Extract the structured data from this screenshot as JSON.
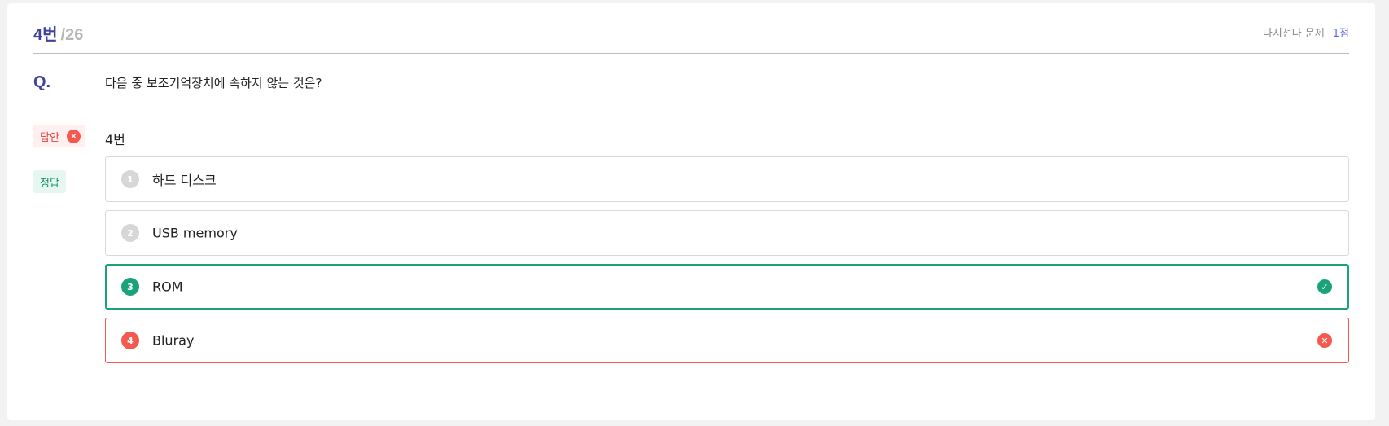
{
  "question": {
    "number": "4번",
    "total": "/26",
    "type": "다지선다 문제",
    "points": "1점",
    "label": "Q.",
    "text": "다음 중 보조기억장치에 속하지 않는 것은?"
  },
  "answer": {
    "tag": "답안",
    "value": "4번",
    "status_icon": "x-circle-icon"
  },
  "correct": {
    "tag": "정답"
  },
  "options": [
    {
      "num": "1",
      "text": "하드 디스크",
      "state": "normal"
    },
    {
      "num": "2",
      "text": "USB memory",
      "state": "normal"
    },
    {
      "num": "3",
      "text": "ROM",
      "state": "correct",
      "icon": "check-circle-icon"
    },
    {
      "num": "4",
      "text": "Bluray",
      "state": "wrong",
      "icon": "x-circle-icon"
    }
  ],
  "colors": {
    "accent": "#3f4499",
    "correct": "#1aa37a",
    "wrong": "#f4594f",
    "points": "#5b6be6"
  }
}
